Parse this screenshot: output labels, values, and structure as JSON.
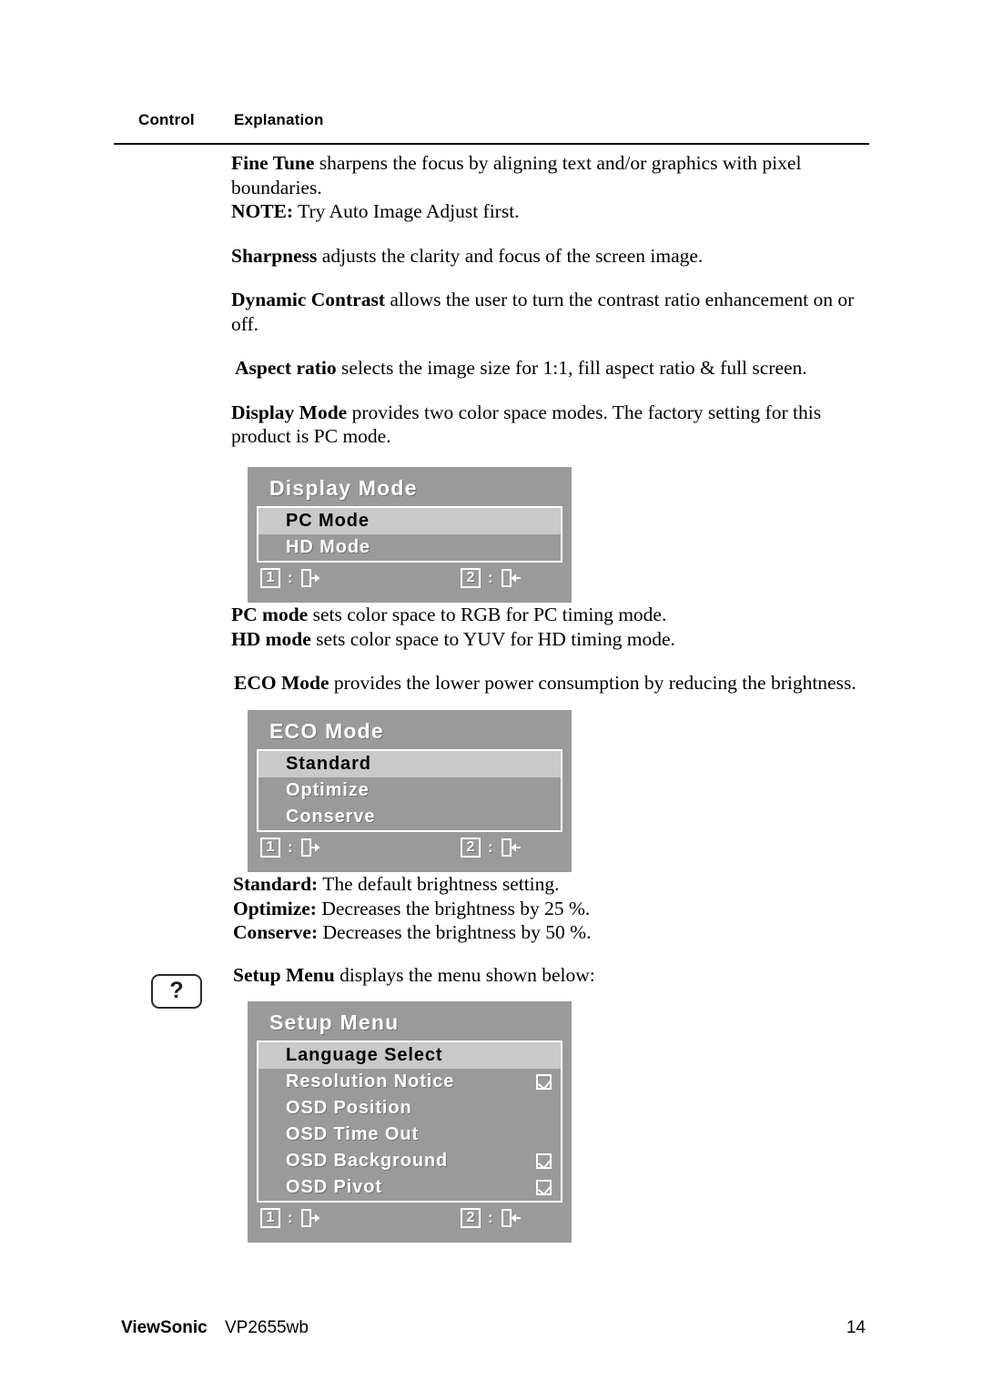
{
  "table_header": {
    "control": "Control",
    "explanation": "Explanation"
  },
  "paragraphs": {
    "fine_tune_label": "Fine Tune",
    "fine_tune_text": " sharpens the focus by aligning text and/or graphics with pixel boundaries.",
    "note_label": "NOTE:",
    "note_text": " Try Auto Image Adjust first.",
    "sharpness_label": "Sharpness",
    "sharpness_text": " adjusts the clarity and focus of the screen image.",
    "dynamic_contrast_label": "Dynamic Contrast",
    "dynamic_contrast_text": " allows the user to turn the contrast ratio enhancement on or off.",
    "aspect_ratio_label": "Aspect ratio",
    "aspect_ratio_text": " selects the image size for 1:1, fill aspect ratio & full screen.",
    "display_mode_label": "Display Mode",
    "display_mode_text": " provides two color space modes. The factory setting for this product is PC mode.",
    "pc_mode_label": "PC mode",
    "pc_mode_text": " sets color space to RGB for PC timing mode.",
    "hd_mode_label": "HD mode",
    "hd_mode_text": " sets color space to YUV for HD timing mode.",
    "eco_mode_label": "ECO Mode",
    "eco_mode_text": " provides the lower power consumption by reducing the brightness.",
    "standard_label": "Standard:",
    "standard_text": " The default brightness setting.",
    "optimize_label": "Optimize:",
    "optimize_text": " Decreases the brightness by 25 %.",
    "conserve_label": "Conserve:",
    "conserve_text": " Decreases the brightness by 50 %.",
    "setup_menu_label": "Setup Menu",
    "setup_menu_text": " displays the menu shown below:"
  },
  "help_key": {
    "glyph": "?"
  },
  "osd_display_mode": {
    "title": "Display Mode",
    "items": [
      {
        "label": "PC Mode",
        "selected": true,
        "checkbox": false
      },
      {
        "label": "HD Mode",
        "selected": false,
        "checkbox": false
      }
    ],
    "footer": {
      "key1": "1",
      "key2": "2",
      "separator": ":",
      "icon1": "exit-door-right-icon",
      "icon2": "enter-door-left-icon"
    }
  },
  "osd_eco_mode": {
    "title": "ECO Mode",
    "items": [
      {
        "label": "Standard",
        "selected": true,
        "checkbox": false
      },
      {
        "label": "Optimize",
        "selected": false,
        "checkbox": false
      },
      {
        "label": "Conserve",
        "selected": false,
        "checkbox": false
      }
    ],
    "footer": {
      "key1": "1",
      "key2": "2",
      "separator": ":",
      "icon1": "exit-door-right-icon",
      "icon2": "enter-door-left-icon"
    }
  },
  "osd_setup_menu": {
    "title": "Setup Menu",
    "items": [
      {
        "label": "Language Select",
        "selected": true,
        "checkbox": false
      },
      {
        "label": "Resolution Notice",
        "selected": false,
        "checkbox": true
      },
      {
        "label": "OSD Position",
        "selected": false,
        "checkbox": false
      },
      {
        "label": "OSD Time Out",
        "selected": false,
        "checkbox": false
      },
      {
        "label": "OSD Background",
        "selected": false,
        "checkbox": true
      },
      {
        "label": "OSD Pivot",
        "selected": false,
        "checkbox": true
      }
    ],
    "footer": {
      "key1": "1",
      "key2": "2",
      "separator": ":",
      "icon1": "exit-door-right-icon",
      "icon2": "enter-door-left-icon"
    }
  },
  "footer": {
    "brand": "ViewSonic",
    "model": "VP2655wb",
    "page_number": "14"
  },
  "colors": {
    "osd_panel": "#9a9a9a",
    "osd_selected_row": "#c9c9c9",
    "osd_border": "#ffffff",
    "text": "#000000"
  }
}
